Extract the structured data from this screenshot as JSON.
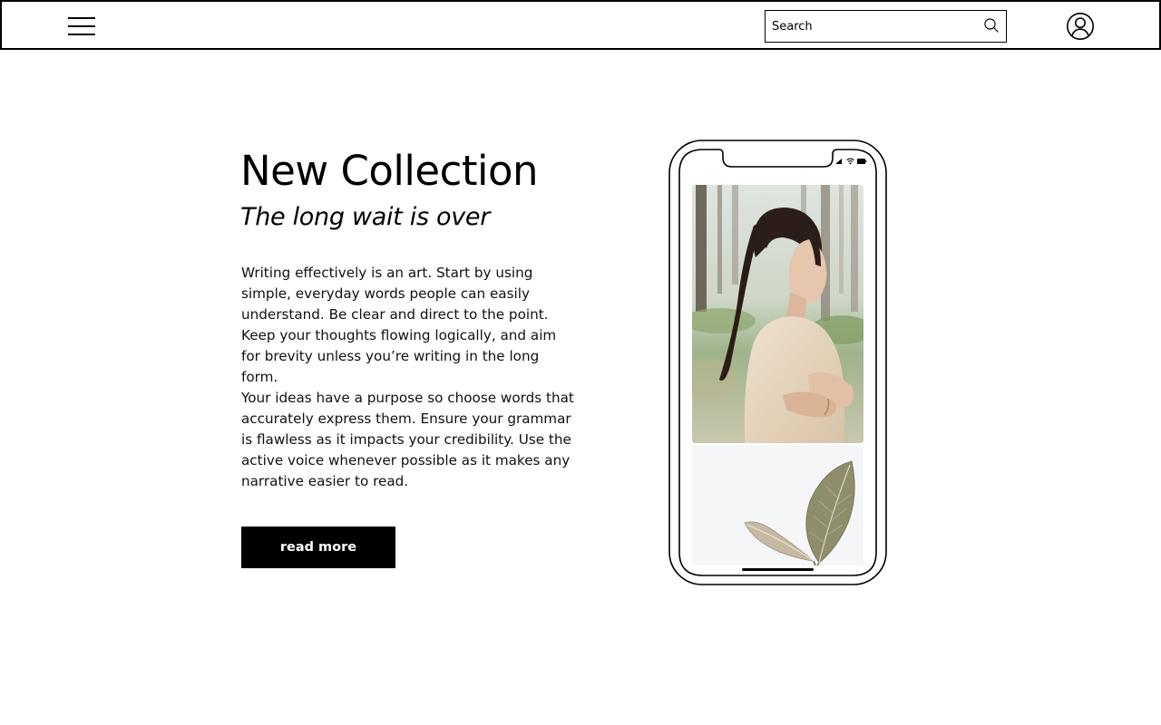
{
  "header": {
    "menu_icon": "hamburger-menu-icon",
    "search": {
      "placeholder": "Search",
      "value": "",
      "icon": "search-icon"
    },
    "account_icon": "user-account-icon"
  },
  "hero": {
    "title": "New Collection",
    "subtitle": "The long wait is over",
    "paragraphs": [
      "Writing effectively is an art. Start by using simple, everyday words people can easily understand. Be clear and direct to the point. Keep your thoughts flowing logically, and aim for brevity unless you’re writing in the long form.",
      "Your ideas have a purpose so choose words that accurately express them. Ensure your grammar is flawless as it impacts your credibility. Use the active voice whenever possible as it makes any narrative easier to read."
    ],
    "cta_label": "read more"
  },
  "phone": {
    "status_icons": [
      "cellular-signal-icon",
      "wifi-icon",
      "battery-icon"
    ],
    "images": [
      "woman-portrait-photo",
      "dried-leaves-photo"
    ]
  },
  "colors": {
    "primary": "#000000",
    "background": "#ffffff",
    "leaf_card_bg": "#f4f6f7"
  }
}
